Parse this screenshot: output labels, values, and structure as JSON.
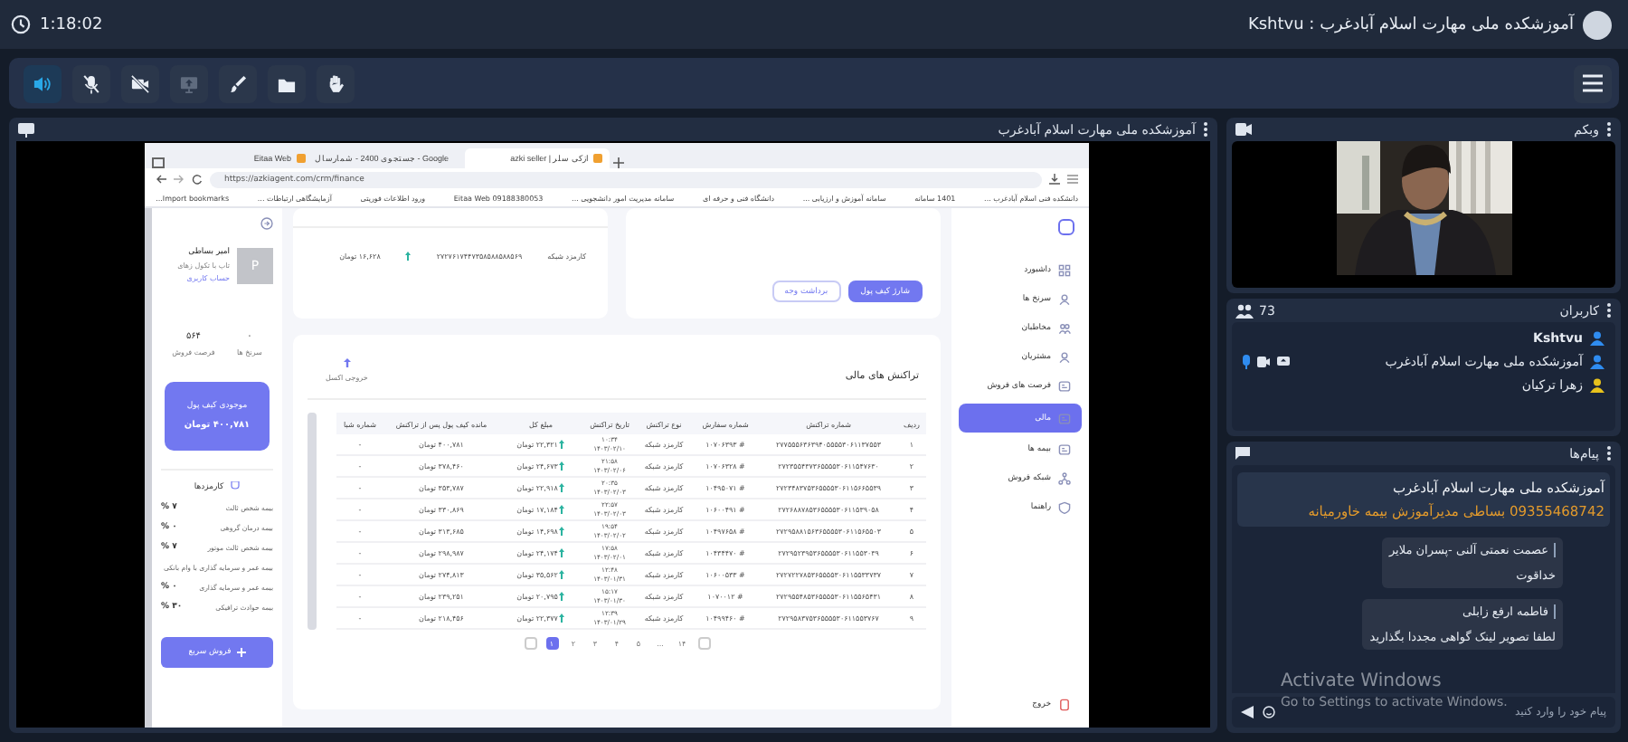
{
  "top_bar": {
    "timer": "1:18:02",
    "title": "Kshtvu : آموزشکده ملی مهارت اسلام آبادغرب"
  },
  "toolbar": {
    "buttons": [
      {
        "kind": "speaker",
        "on": true,
        "disabled": false
      },
      {
        "kind": "mic",
        "on": false,
        "disabled": false
      },
      {
        "kind": "camera",
        "on": false,
        "disabled": false
      },
      {
        "kind": "screen",
        "on": false,
        "disabled": true
      },
      {
        "kind": "brush",
        "on": false,
        "disabled": false
      },
      {
        "kind": "folder",
        "on": false,
        "disabled": false
      },
      {
        "kind": "hand",
        "on": false,
        "disabled": false
      }
    ]
  },
  "presentation": {
    "title": "آموزشکده ملی مهارت اسلام آبادغرب",
    "browser": {
      "tabs": [
        {
          "label": "ازکی سلر | azki seller",
          "selected": true
        },
        {
          "label": "Google - جستجوی 2400 - شمارسال",
          "selected": false
        },
        {
          "label": "Eitaa Web",
          "selected": false
        }
      ],
      "url": "https://azkiagent.com/crm/finance",
      "bookmarks": [
        "دانشکده فنی اسلام آبادغرب ...",
        "1401 سامانه",
        "سامانه آموزش و ارزیابی ...",
        "دانشگاه فنی و حرفه ای",
        "سامانه مدیریت امور دانشجویی ...",
        "Eitaa Web 09188380053",
        "ورود اطلاعات فوریتی",
        "آزمایشگاهی ارتباطات ...",
        "Import bookmarks..."
      ]
    },
    "app": {
      "nav": [
        {
          "label": "داشبورد",
          "selected": false
        },
        {
          "label": "سرنخ ها",
          "selected": false
        },
        {
          "label": "مخاطبان",
          "selected": false
        },
        {
          "label": "مشتریان",
          "selected": false
        },
        {
          "label": "فرصت های فروش",
          "selected": false
        },
        {
          "label": "مالی",
          "selected": true
        },
        {
          "label": "بیمه ها",
          "selected": false
        },
        {
          "label": "شبکه فروش",
          "selected": false
        },
        {
          "label": "راهنما",
          "selected": false
        }
      ],
      "logout": "خروج",
      "profile": {
        "initial": "P",
        "name": "امیر بساطی",
        "subtitle": "تاپ با تکول زهای",
        "link": "حساب کاربری"
      },
      "stats": [
        {
          "value": "۰",
          "label": "سرنخ ها"
        },
        {
          "value": "۵۶۴",
          "label": "فرصت فروش"
        }
      ],
      "wallet": {
        "label": "موجودی کیف پول",
        "amount": "۴۰۰,۷۸۱ تومان"
      },
      "commissions": {
        "title": "کارمزدها",
        "items": [
          {
            "label": "بیمه شخص ثالث",
            "value": "۷ %"
          },
          {
            "label": "بیمه درمان گروهی",
            "value": "۰ %"
          },
          {
            "label": "بیمه شخص ثالث موتور",
            "value": "۷ %"
          },
          {
            "label": "بیمه عمر و سرمایه گذاری با وام بانکی",
            "value": ""
          },
          {
            "label": "بیمه عمر و سرمایه گذاری",
            "value": "۰ %"
          },
          {
            "label": "بیمه حوادث ترافیکی",
            "value": "۳۰ %"
          }
        ]
      },
      "quick_sale": "فروش سریع",
      "recent": {
        "rows": [
          {
            "type": "کارمزد شبکه",
            "number": "۲۷۲۷۶۱۷۴۴۷۳۵۸۵۸۸۵۸۸۵۶۹",
            "amount": "۱۶,۶۲۸ تومان"
          }
        ]
      },
      "wallet_actions": [
        {
          "label": "شارژ کیف پول",
          "kind": "primary"
        },
        {
          "label": "برداشت وجه",
          "kind": "secondary"
        }
      ],
      "transactions": {
        "title": "تراکنش های مالی",
        "export": "خروجی اکسل",
        "columns": [
          "ردیف",
          "شماره تراکنش",
          "شماره سفارش",
          "نوع تراکنش",
          "تاریخ تراکنش",
          "مبلغ کل",
          "مانده کیف پول پس از تراکنش",
          "شماره شبا"
        ],
        "rows": [
          {
            "index": "۱",
            "transaction": "۲۷۷۵۵۵۶۳۶۳۹۴۰۵۵۵۵۳۰۶۱۱۳۷۵۵۳",
            "order": "# ۱۰۷۰۶۳۹۳",
            "type": "کارمزد شبکه",
            "time": "۱۰:۳۴",
            "date": "۱۴۰۳/۰۲/۱۰",
            "amount": "۲۲,۳۲۱ تومان",
            "balance": "۴۰۰,۷۸۱ تومان",
            "sheba": "-"
          },
          {
            "index": "۲",
            "transaction": "۲۷۲۳۵۵۴۳۷۳۶۵۵۵۵۳۰۶۱۱۵۴۷۶۳۰",
            "order": "# ۱۰۷۰۶۳۲۸",
            "type": "کارمزد شبکه",
            "time": "۲۱:۵۸",
            "date": "۱۴۰۳/۰۲/۰۶",
            "amount": "۲۴,۶۷۳ تومان",
            "balance": "۳۷۸,۴۶۰ تومان",
            "sheba": "-"
          },
          {
            "index": "۳",
            "transaction": "۲۷۲۳۴۸۳۷۵۳۶۵۵۵۵۳۰۶۱۱۵۶۶۵۵۳۹",
            "order": "# ۱۰۴۹۵۰۷۱",
            "type": "کارمزد شبکه",
            "time": "۲۰:۳۵",
            "date": "۱۴۰۳/۰۲/۰۳",
            "amount": "۲۲,۹۱۸ تومان",
            "balance": "۳۵۳,۷۸۷ تومان",
            "sheba": "-"
          },
          {
            "index": "۴",
            "transaction": "۲۷۲۶۸۸۷۸۵۳۶۵۵۵۵۳۰۶۱۱۵۳۹۰۵۸",
            "order": "# ۱۰۶۰۰۴۹۱",
            "type": "کارمزد شبکه",
            "time": "۲۲:۵۷",
            "date": "۱۴۰۳/۰۲/۰۳",
            "amount": "۱۷,۱۸۴ تومان",
            "balance": "۳۳۰,۸۶۹ تومان",
            "sheba": "-"
          },
          {
            "index": "۵",
            "transaction": "۲۷۲۹۵۸۸۱۵۶۳۶۵۵۵۵۳۰۶۱۱۵۶۵۵۰۳",
            "order": "# ۱۰۴۹۷۶۵۸",
            "type": "کارمزد شبکه",
            "time": "۱۹:۵۴",
            "date": "۱۴۰۳/۰۲/۰۲",
            "amount": "۱۴,۶۹۸ تومان",
            "balance": "۳۱۳,۶۸۵ تومان",
            "sheba": "-"
          },
          {
            "index": "۶",
            "transaction": "۲۷۲۹۵۲۳۹۵۳۶۵۵۵۵۳۰۶۱۱۵۵۳۰۳۹",
            "order": "# ۱۰۴۳۴۴۷۰",
            "type": "کارمزد شبکه",
            "time": "۱۷:۵۸",
            "date": "۱۴۰۳/۰۲/۰۱",
            "amount": "۲۴,۱۷۴ تومان",
            "balance": "۲۹۸,۹۸۷ تومان",
            "sheba": "-"
          },
          {
            "index": "۷",
            "transaction": "۲۷۲۷۲۲۷۸۵۳۶۵۵۵۵۳۰۶۱۱۵۵۳۳۷۳۷",
            "order": "# ۱۰۶۰۰۵۳۳",
            "type": "کارمزد شبکه",
            "time": "۱۲:۴۸",
            "date": "۱۴۰۳/۰۱/۳۱",
            "amount": "۳۵,۵۶۲ تومان",
            "balance": "۲۷۴,۸۱۳ تومان",
            "sheba": "-"
          },
          {
            "index": "۸",
            "transaction": "۲۷۲۹۵۵۴۸۵۳۶۵۵۵۵۳۰۶۱۱۵۵۶۵۴۳۱",
            "order": "# ۱۰۷۰۰۱۲",
            "type": "کارمزد شبکه",
            "time": "۱۵:۱۷",
            "date": "۱۴۰۳/۰۱/۳۰",
            "amount": "۲۰,۷۹۵ تومان",
            "balance": "۲۳۹,۲۵۱ تومان",
            "sheba": "-"
          },
          {
            "index": "۹",
            "transaction": "۲۷۲۹۵۸۳۷۵۳۶۵۵۵۵۳۰۶۱۱۵۵۳۷۶۷",
            "order": "# ۱۰۴۹۹۴۶۰",
            "type": "کارمزد شبکه",
            "time": "۱۲:۳۹",
            "date": "۱۴۰۳/۰۱/۲۹",
            "amount": "۲۲,۳۷۷ تومان",
            "balance": "۲۱۸,۴۵۶ تومان",
            "sheba": "-"
          }
        ]
      },
      "pagination": [
        {
          "label": "۱۴",
          "selected": false
        },
        {
          "label": "...",
          "selected": false
        },
        {
          "label": "۵",
          "selected": false
        },
        {
          "label": "۴",
          "selected": false
        },
        {
          "label": "۳",
          "selected": false
        },
        {
          "label": "۲",
          "selected": false
        },
        {
          "label": "۱",
          "selected": true
        }
      ]
    }
  },
  "webcam": {
    "title": "وبکم"
  },
  "users": {
    "title": "کاربران",
    "count": "73",
    "items": [
      {
        "name": "Kshtvu",
        "color": "#2f8cf0",
        "current_user": true,
        "media": false
      },
      {
        "name": "آموزشکده ملی مهارت اسلام آبادغرب",
        "color": "#2f8cf0",
        "current_user": false,
        "media": true
      },
      {
        "name": "زهرا ترکیان",
        "color": "#e8c21c",
        "current_user": false,
        "media": false
      }
    ]
  },
  "messages": {
    "title": "پیام‌ها",
    "items": [
      {
        "kind": "announcement",
        "sender": "آموزشکده ملی مهارت اسلام آبادغرب",
        "text": "09355468742 بساطی مدیرآموزش بیمه خاورمیانه"
      },
      {
        "kind": "message",
        "sender": "عصمت نعمتی آلنی -پسران ملایر",
        "text": "خداقوت"
      },
      {
        "kind": "message",
        "sender": "فاطمه ارفع زابلی",
        "text": "لطفا تصویر لینک گواهی مجددا بگذارید"
      }
    ],
    "input": {
      "placeholder": "پیام خود را وارد کنید"
    }
  },
  "os_overlay": {
    "title": "Activate Windows",
    "subtitle": "Go to Settings to activate Windows."
  }
}
